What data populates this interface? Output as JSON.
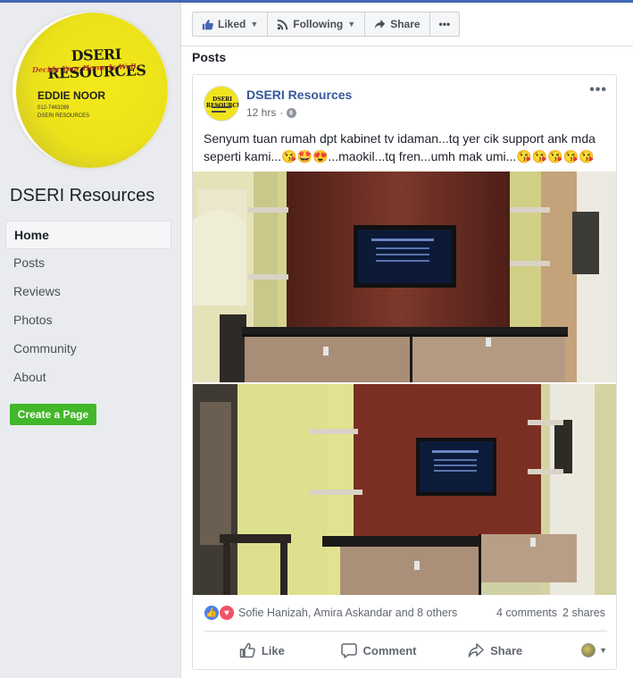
{
  "page": {
    "name": "DSERI Resources",
    "profile_card": {
      "logo_text": "DSERI RESOURCES",
      "tagline": "Decide Your Home Is Well",
      "person": "EDDIE NOOR",
      "phone": "012-7463289",
      "fb": "DSERI RESOURCES"
    }
  },
  "sidebar": {
    "items": [
      {
        "label": "Home"
      },
      {
        "label": "Posts"
      },
      {
        "label": "Reviews"
      },
      {
        "label": "Photos"
      },
      {
        "label": "Community"
      },
      {
        "label": "About"
      }
    ],
    "create_page": "Create a Page"
  },
  "actionbar": {
    "liked": "Liked",
    "following": "Following",
    "share": "Share",
    "more": "•••"
  },
  "section_title": "Posts",
  "post": {
    "author": "DSERI Resources",
    "time": "12 hrs",
    "menu": "•••",
    "text": "Senyum tuan rumah dpt kabinet tv idaman...tq yer cik support ank mda seperti kami...😘🤩😍...maokil...tq fren...umh mak umi...😘😘😘😘😘",
    "reactions_text": "Sofie Hanizah, Amira Askandar and 8 others",
    "comments": "4 comments",
    "shares": "2 shares",
    "actions": {
      "like": "Like",
      "comment": "Comment",
      "share": "Share"
    }
  },
  "colors": {
    "brand_blue": "#4267b2",
    "link": "#365899",
    "create_green": "#42b72a"
  }
}
